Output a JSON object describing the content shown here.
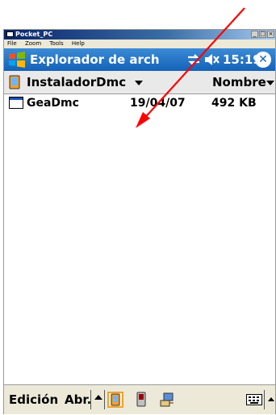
{
  "window": {
    "title": "Pocket_PC",
    "controls": [
      "_",
      "□",
      "×"
    ]
  },
  "menu": {
    "items": [
      "File",
      "Zoom",
      "Tools",
      "Help"
    ]
  },
  "startbar": {
    "app_title": "Explorador de arch",
    "time": "15:19",
    "icons": [
      "windows-flag-icon",
      "connectivity-icon",
      "volume-icon",
      "close-circle-icon"
    ],
    "close_glyph": "✕"
  },
  "folder": {
    "name": "InstaladorDmc",
    "sort_label": "Nombre"
  },
  "files": [
    {
      "name": "GeaDmc",
      "date": "19/04/07",
      "size": "492 KB",
      "icon": "application-icon"
    }
  ],
  "commandbar": {
    "edit_label": "Edición",
    "open_label": "Abr.",
    "tools": [
      "device-icon",
      "storage-card-icon",
      "network-icon"
    ],
    "keyboard_icon": "keyboard-icon"
  },
  "colors": {
    "startbar": "#1a6ac4",
    "annotation_arrow": "#ff0000",
    "highlight": "#f0a030"
  }
}
